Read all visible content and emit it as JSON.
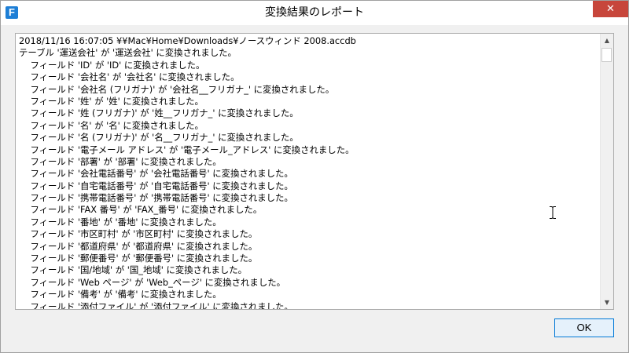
{
  "window": {
    "title": "変換結果のレポート",
    "app_icon_letter": "F",
    "close_glyph": "✕"
  },
  "log": {
    "lines": [
      "2018/11/16 16:07:05 ¥¥Mac¥Home¥Downloads¥ノースウィンド 2008.accdb",
      "テーブル '運送会社' が '運送会社' に変換されました。",
      "    フィールド 'ID' が 'ID' に変換されました。",
      "    フィールド '会社名' が '会社名' に変換されました。",
      "    フィールド '会社名 (フリガナ)' が '会社名__フリガナ_' に変換されました。",
      "    フィールド '姓' が '姓' に変換されました。",
      "    フィールド '姓 (フリガナ)' が '姓__フリガナ_' に変換されました。",
      "    フィールド '名' が '名' に変換されました。",
      "    フィールド '名 (フリガナ)' が '名__フリガナ_' に変換されました。",
      "    フィールド '電子メール アドレス' が '電子メール_アドレス' に変換されました。",
      "    フィールド '部署' が '部署' に変換されました。",
      "    フィールド '会社電話番号' が '会社電話番号' に変換されました。",
      "    フィールド '自宅電話番号' が '自宅電話番号' に変換されました。",
      "    フィールド '携帯電話番号' が '携帯電話番号' に変換されました。",
      "    フィールド 'FAX 番号' が 'FAX_番号' に変換されました。",
      "    フィールド '番地' が '番地' に変換されました。",
      "    フィールド '市区町村' が '市区町村' に変換されました。",
      "    フィールド '都道府県' が '都道府県' に変換されました。",
      "    フィールド '郵便番号' が '郵便番号' に変換されました。",
      "    フィールド '国/地域' が '国_地域' に変換されました。",
      "    フィールド 'Web ページ' が 'Web_ページ' に変換されました。",
      "    フィールド '備考' が '備考' に変換されました。",
      "    フィールド '添付ファイル' が '添付ファイル' に変換されました。"
    ]
  },
  "scrollbar": {
    "up_glyph": "▲",
    "down_glyph": "▼"
  },
  "ok_label": "OK",
  "colors": {
    "close_button": "#c7463b",
    "ok_border": "#0078d7",
    "app_icon": "#1e7fd6"
  }
}
